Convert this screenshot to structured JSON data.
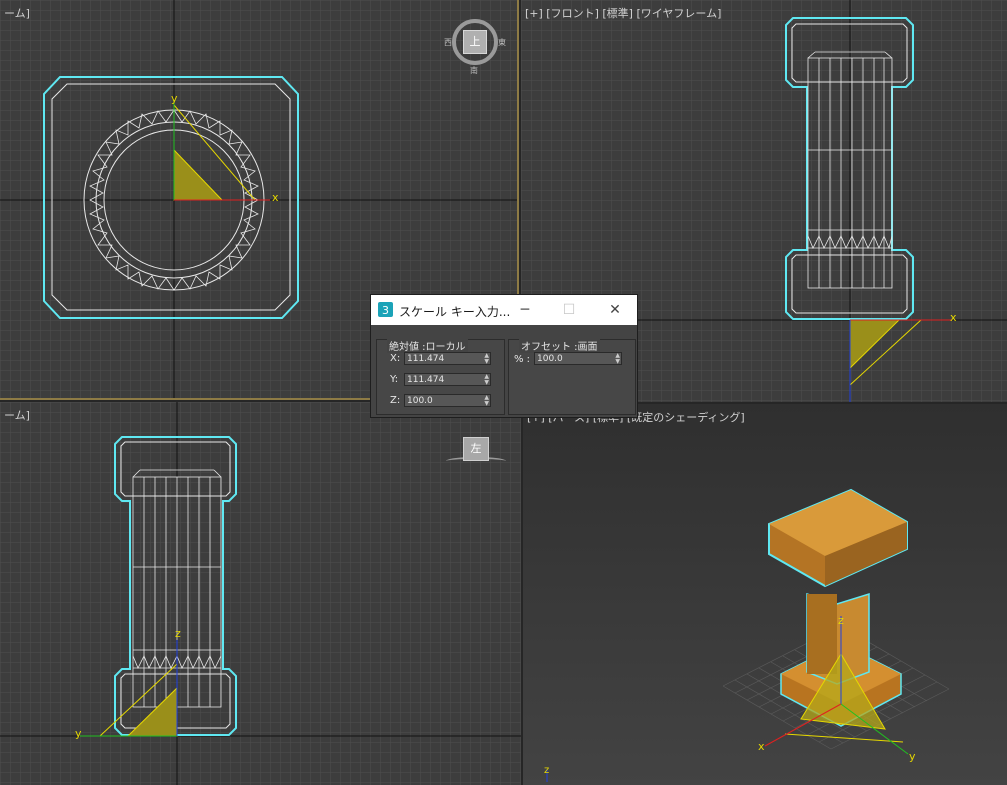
{
  "viewports": {
    "top": {
      "label": "ーム]"
    },
    "front": {
      "label": "[+] [フロント] [標準] [ワイヤフレーム]"
    },
    "left": {
      "label": "ーム]"
    },
    "perspective": {
      "label": "[+] [パース] [標準] [既定のシェーディング]"
    }
  },
  "viewcube": {
    "top_face": "上",
    "west": "西",
    "east": "東",
    "south": "南",
    "left_face": "左"
  },
  "axes": {
    "x": "x",
    "y": "y",
    "z": "z"
  },
  "dialog": {
    "title": "スケール キー入力...",
    "absolute_group": "絶対値 :ローカル",
    "offset_group": "オフセット :画面",
    "x_label": "X:",
    "y_label": "Y:",
    "z_label": "Z:",
    "x_value": "111.474",
    "y_value": "111.474",
    "z_value": "100.0",
    "percent_label": "% :",
    "percent_value": "100.0"
  },
  "colors": {
    "selection": "#5fe8f2",
    "wire": "#ffffff",
    "gizmo": "#e6d800",
    "object": "#c88a30",
    "viewport_bg": "#3d3d3d",
    "grid": "#555555"
  }
}
